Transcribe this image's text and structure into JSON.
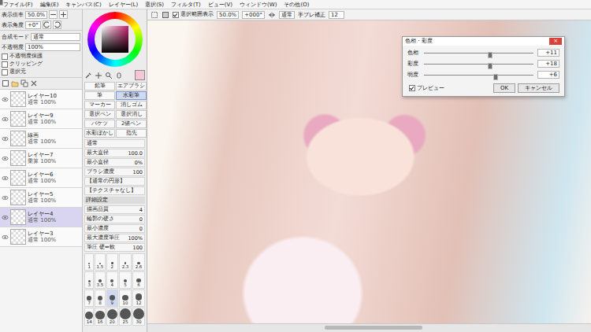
{
  "menu": [
    "ファイル(F)",
    "編集(E)",
    "キャンバス(C)",
    "レイヤー(L)",
    "選択(S)",
    "フィルタ(T)",
    "ビュー(V)",
    "ウィンドウ(W)",
    "その他(O)"
  ],
  "toolbar": {
    "selection_display": {
      "label": "選択範囲表示",
      "checked": true
    },
    "zoom": "50.0%",
    "angle": "+000°",
    "blend": "通常",
    "stabilizer_label": "手ブレ補正",
    "stabilizer": "12"
  },
  "navigator": {
    "zoom_label": "表示倍率",
    "zoom": "50.0%",
    "angle_label": "表示角度",
    "angle": "+0°"
  },
  "layer_props": {
    "rows": [
      {
        "label": "合成モード",
        "value": "通常"
      },
      {
        "label": "不透明度",
        "value": "100%"
      }
    ],
    "options": [
      {
        "label": "不透明度保護",
        "checked": false
      },
      {
        "label": "クリッピング",
        "checked": false
      },
      {
        "label": "選択元",
        "checked": false
      }
    ]
  },
  "layers": [
    {
      "name": "レイヤー10",
      "mode": "通常",
      "opacity": "100%",
      "visible": true,
      "selected": false
    },
    {
      "name": "レイヤー9",
      "mode": "通常",
      "opacity": "100%",
      "visible": true,
      "selected": false
    },
    {
      "name": "線画",
      "mode": "通常",
      "opacity": "100%",
      "visible": true,
      "selected": false
    },
    {
      "name": "レイヤー7",
      "mode": "乗算",
      "opacity": "100%",
      "visible": true,
      "selected": false
    },
    {
      "name": "レイヤー6",
      "mode": "通常",
      "opacity": "100%",
      "visible": true,
      "selected": false
    },
    {
      "name": "レイヤー5",
      "mode": "通常",
      "opacity": "100%",
      "visible": true,
      "selected": false
    },
    {
      "name": "レイヤー4",
      "mode": "通常",
      "opacity": "100%",
      "visible": true,
      "selected": true
    },
    {
      "name": "レイヤー3",
      "mode": "通常",
      "opacity": "100%",
      "visible": true,
      "selected": false
    }
  ],
  "current_color": "#f7c6d6",
  "tools": [
    {
      "label": "鉛筆",
      "selected": false
    },
    {
      "label": "エアブラシ",
      "selected": false
    },
    {
      "label": "筆",
      "selected": false
    },
    {
      "label": "水彩筆",
      "selected": true
    },
    {
      "label": "マーカー",
      "selected": false
    },
    {
      "label": "消しゴム",
      "selected": false
    },
    {
      "label": "選択ペン",
      "selected": false
    },
    {
      "label": "選択消し",
      "selected": false
    },
    {
      "label": "バケツ",
      "selected": false
    },
    {
      "label": "2値ペン",
      "selected": false
    },
    {
      "label": "水彩ぼかし",
      "selected": false
    },
    {
      "label": "指先",
      "selected": false
    }
  ],
  "brush": [
    {
      "label": "通常",
      "value": ""
    },
    {
      "label": "最大直径",
      "value": "100.0"
    },
    {
      "label": "最小直径",
      "value": "0%"
    },
    {
      "label": "ブラシ濃度",
      "value": "100"
    },
    {
      "label": "【通常の円形】",
      "value": ""
    },
    {
      "label": "【テクスチャなし】",
      "value": ""
    }
  ],
  "details": {
    "title": "詳細設定",
    "rows": [
      {
        "label": "描画品質",
        "value": "4"
      },
      {
        "label": "輪郭の硬さ",
        "value": "0"
      },
      {
        "label": "最小濃度",
        "value": "0"
      },
      {
        "label": "最大濃度筆圧",
        "value": "100%"
      },
      {
        "label": "筆圧 硬⇔軟",
        "value": "100"
      }
    ]
  },
  "sizes": [
    {
      "label": "1",
      "selected": false
    },
    {
      "label": "1.5",
      "selected": false
    },
    {
      "label": "2",
      "selected": false
    },
    {
      "label": "2.3",
      "selected": false
    },
    {
      "label": "2.6",
      "selected": false
    },
    {
      "label": "3",
      "selected": false
    },
    {
      "label": "3.5",
      "selected": false
    },
    {
      "label": "4",
      "selected": false
    },
    {
      "label": "5",
      "selected": false
    },
    {
      "label": "6",
      "selected": false
    },
    {
      "label": "7",
      "selected": false
    },
    {
      "label": "8",
      "selected": false
    },
    {
      "label": "9",
      "selected": true
    },
    {
      "label": "10",
      "selected": false
    },
    {
      "label": "12",
      "selected": false
    },
    {
      "label": "14",
      "selected": false
    },
    {
      "label": "16",
      "selected": false
    },
    {
      "label": "20",
      "selected": false
    },
    {
      "label": "25",
      "selected": false
    },
    {
      "label": "30",
      "selected": false
    }
  ],
  "dialog": {
    "title": "色相・彩度",
    "close": "×",
    "sliders": [
      {
        "label": "色相",
        "level": 0.6,
        "value": "+11"
      },
      {
        "label": "彩度",
        "level": 0.6,
        "value": "+18"
      },
      {
        "label": "明度",
        "level": 0.65,
        "value": "+6"
      }
    ],
    "preview": {
      "label": "プレビュー",
      "checked": true
    },
    "buttons": [
      "OK",
      "キャンセル"
    ]
  }
}
